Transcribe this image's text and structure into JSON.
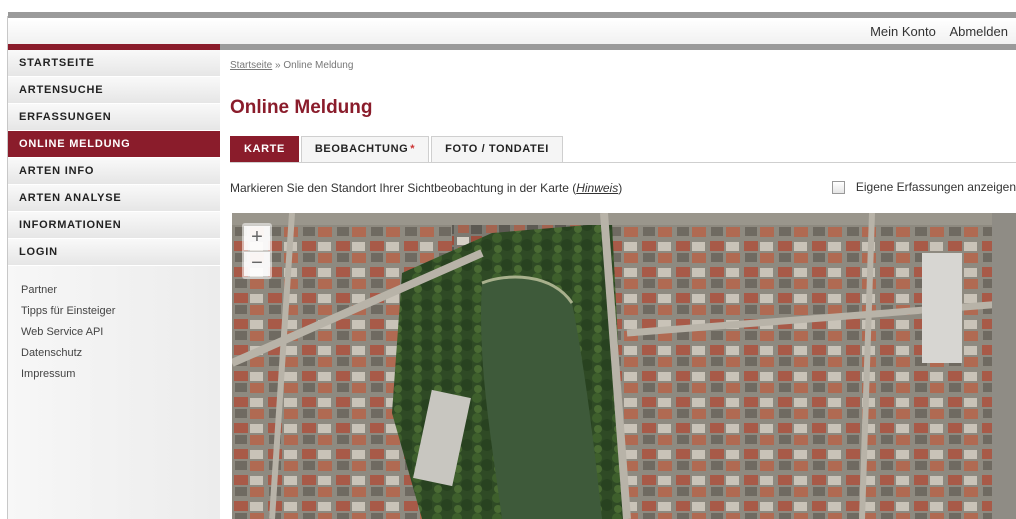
{
  "header": {
    "account_label": "Mein Konto",
    "logout_label": "Abmelden"
  },
  "sidebar": {
    "items": [
      {
        "label": "STARTSEITE"
      },
      {
        "label": "ARTENSUCHE"
      },
      {
        "label": "ERFASSUNGEN"
      },
      {
        "label": "ONLINE MELDUNG",
        "active": true
      },
      {
        "label": "ARTEN INFO"
      },
      {
        "label": "ARTEN ANALYSE"
      },
      {
        "label": "INFORMATIONEN"
      },
      {
        "label": "LOGIN"
      }
    ],
    "links": [
      {
        "label": "Partner"
      },
      {
        "label": "Tipps für Einsteiger"
      },
      {
        "label": "Web Service API"
      },
      {
        "label": "Datenschutz"
      },
      {
        "label": "Impressum"
      }
    ]
  },
  "breadcrumb": {
    "home": "Startseite",
    "separator": " » ",
    "current": "Online Meldung"
  },
  "page": {
    "title": "Online Meldung"
  },
  "tabs": [
    {
      "label": "KARTE",
      "active": true
    },
    {
      "label": "BEOBACHTUNG",
      "required_mark": "*"
    },
    {
      "label": "FOTO / TONDATEI"
    }
  ],
  "instruction": {
    "text_before": "Markieren Sie den Standort Ihrer Sichtbeobachtung in der Karte (",
    "link": "Hinweis",
    "text_after": ")"
  },
  "own_entries": {
    "label": "Eigene Erfassungen anzeigen",
    "checked": false
  },
  "map": {
    "zoom_in": "+",
    "zoom_out": "−",
    "type": "satellite aerial"
  },
  "colors": {
    "accent": "#8a1c2b",
    "water": "#3e5a3a"
  }
}
